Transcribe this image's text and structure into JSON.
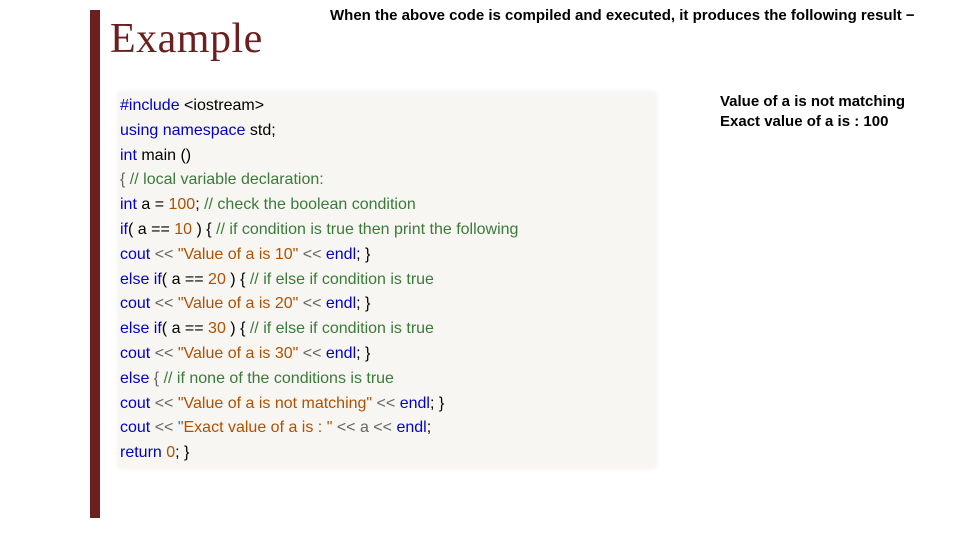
{
  "heading": "Example",
  "intro": "When the above code is compiled and executed, it produces the following result −",
  "output": {
    "line1": "Value of a is not matching",
    "line2": "Exact value of a is : 100"
  },
  "code": {
    "l1_include": "#include",
    "l1_hdr": " <iostream>",
    "l2_using": "using namespace",
    "l2_std": " std;",
    "l3_int": "int",
    "l3_main": " main ()",
    "l4_brace": "{ ",
    "l4_cmt": "// local variable declaration:",
    "l5_int": "int",
    "l5_decl": " a = ",
    "l5_num": "100",
    "l5_semi": "; ",
    "l5_cmt": "// check the boolean condition",
    "l6_if": "if",
    "l6_cond": "( a == ",
    "l6_num": "10",
    "l6_cond2": " ) { ",
    "l6_cmt": "// if condition is true then print the following",
    "l7_cout": "cout",
    "l7_op1": " << ",
    "l7_str": "\"Value of a is 10\"",
    "l7_op2": " << ",
    "l7_endl": "endl",
    "l7_end": "; }",
    "l8_else": "else if",
    "l8_cond": "( a == ",
    "l8_num": "20",
    "l8_cond2": " ) { ",
    "l8_cmt": "// if else if condition is true",
    "l9_cout": "cout",
    "l9_op1": " << ",
    "l9_str": "\"Value of a is 20\"",
    "l9_op2": " << ",
    "l9_endl": "endl",
    "l9_end": "; }",
    "l10_else": "else if",
    "l10_cond": "( a == ",
    "l10_num": "30",
    "l10_cond2": " ) { ",
    "l10_cmt": "// if else if condition is true",
    "l11_cout": "cout",
    "l11_op1": " << ",
    "l11_str": "\"Value of a is 30\"",
    "l11_op2": " << ",
    "l11_endl": "endl",
    "l11_end": "; }",
    "l12_else": "else",
    "l12_brace": " { ",
    "l12_cmt": "// if none of the conditions is true",
    "l13_cout": "cout",
    "l13_op1": " << ",
    "l13_str": "\"Value of a is not matching\"",
    "l13_op2": " << ",
    "l13_endl": "endl",
    "l13_end": "; }",
    "l14_cout": "cout",
    "l14_op1": " << ",
    "l14_str": "\"Exact value of a is : \"",
    "l14_op2": " << a << ",
    "l14_endl": "endl",
    "l14_end": ";",
    "l15_return": "return",
    "l15_val": " ",
    "l15_num": "0",
    "l15_end": "; }"
  }
}
